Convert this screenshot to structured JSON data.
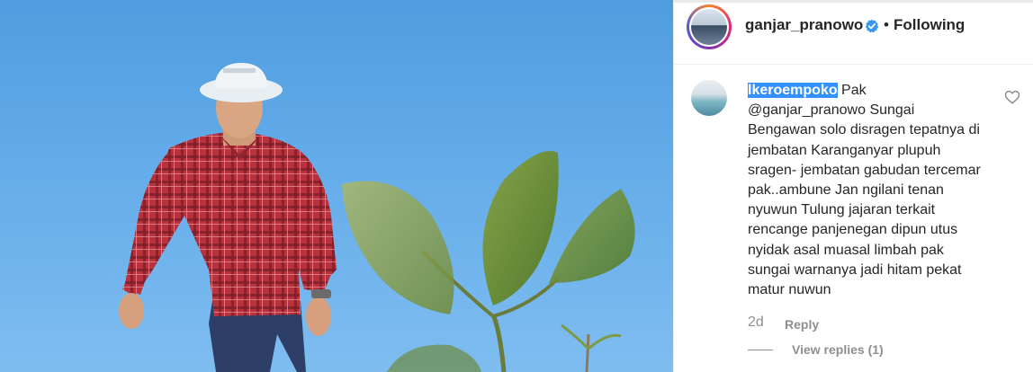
{
  "post": {
    "author": "ganjar_pranowo",
    "verified": true,
    "separator": "•",
    "follow_status": "Following"
  },
  "comment": {
    "username": "lkeroempoko",
    "text": " Pak @ganjar_pranowo Sungai Bengawan solo disragen tepatnya di jembatan Karanganyar plupuh sragen- jembatan gabudan tercemar pak..ambune Jan ngilani tenan nyuwun Tulung jajaran terkait rencange panjenegan dipun utus nyidak asal muasal limbah pak sungai warnanya jadi hitam pekat matur nuwun",
    "age": "2d",
    "reply_label": "Reply",
    "view_replies_label": "View replies (1)"
  },
  "icons": {
    "verified": "verified-badge-icon",
    "like": "heart-outline-icon"
  },
  "colors": {
    "verified_blue": "#3897f0",
    "selection_highlight": "#3390ff",
    "muted_text": "#8e8e8e"
  }
}
